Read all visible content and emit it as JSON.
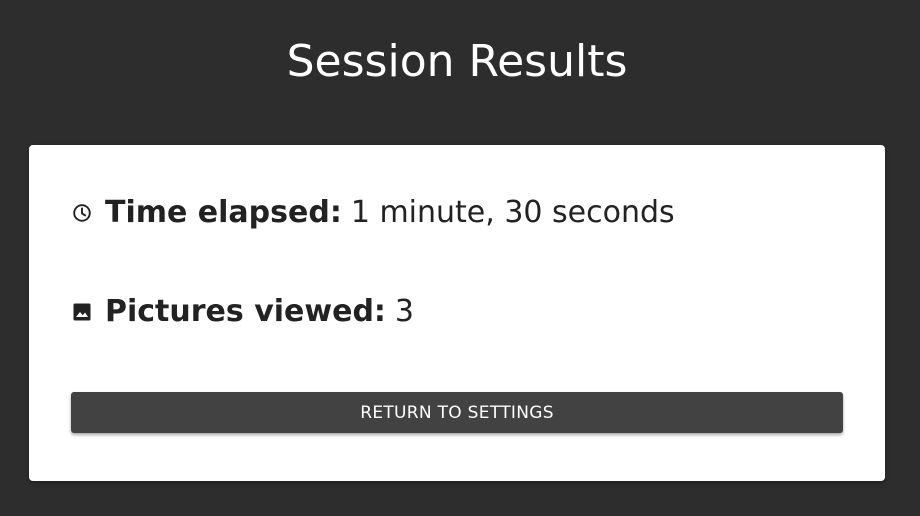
{
  "page": {
    "title": "Session Results"
  },
  "results": {
    "time_elapsed": {
      "icon": "clock-icon",
      "label": "Time elapsed:",
      "value": "1 minute, 30 seconds"
    },
    "pictures_viewed": {
      "icon": "image-icon",
      "label": "Pictures viewed:",
      "value": "3"
    }
  },
  "actions": {
    "return_label": "RETURN TO SETTINGS"
  },
  "colors": {
    "background": "#2d2d2d",
    "card": "#ffffff",
    "button": "#424242",
    "text": "#222222"
  }
}
